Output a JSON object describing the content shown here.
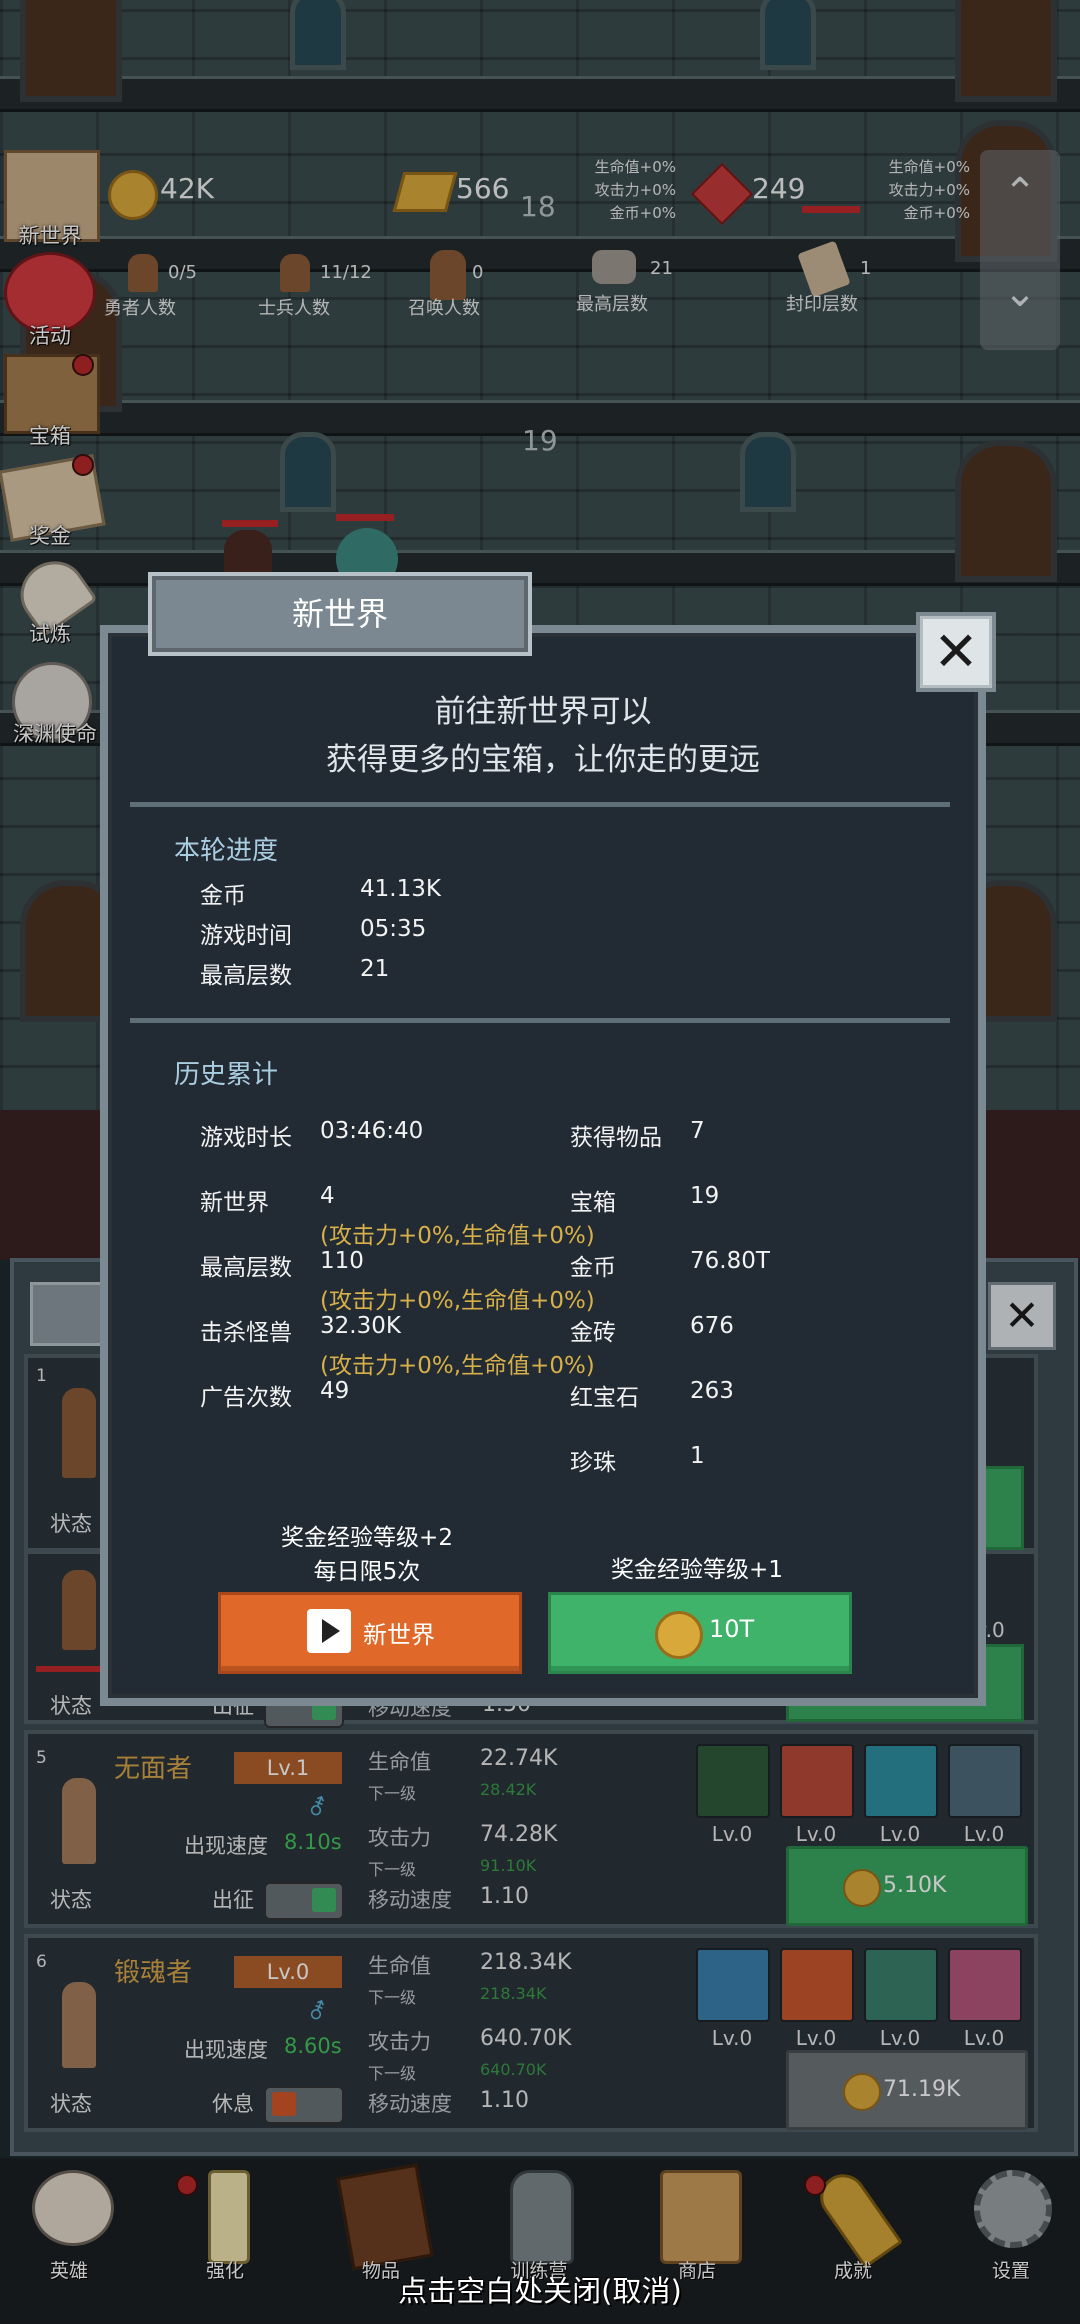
{
  "top": {
    "gold": "42K",
    "gold_bar": "566",
    "ruby": "249",
    "floor_indicator_1": "18",
    "floor_indicator_2": "19",
    "bonus_left": [
      "生命值+0%",
      "攻击力+0%",
      "金币+0%"
    ],
    "bonus_right": [
      "生命值+0%",
      "攻击力+0%",
      "金币+0%"
    ],
    "stats": [
      {
        "value": "0/5",
        "label": "勇者人数"
      },
      {
        "value": "11/12",
        "label": "士兵人数"
      },
      {
        "value": "0",
        "label": "召唤人数"
      },
      {
        "value": "21",
        "label": "最高层数"
      },
      {
        "value": "1",
        "label": "封印层数"
      }
    ]
  },
  "side_menu": [
    {
      "label": "新世界",
      "icon": "map-icon"
    },
    {
      "label": "活动",
      "icon": "heart-icon"
    },
    {
      "label": "宝箱",
      "icon": "chest-icon"
    },
    {
      "label": "奖金",
      "icon": "letter-icon"
    },
    {
      "label": "试炼",
      "icon": "feather-icon"
    },
    {
      "label": "深渊使命",
      "icon": "orb-icon"
    }
  ],
  "dialog": {
    "title": "新世界",
    "intro_line1": "前往新世界可以",
    "intro_line2": "获得更多的宝箱，让你走的更远",
    "round_title": "本轮进度",
    "round": [
      {
        "k": "金币",
        "v": "41.13K"
      },
      {
        "k": "游戏时间",
        "v": "05:35"
      },
      {
        "k": "最高层数",
        "v": "21"
      }
    ],
    "history_title": "历史累计",
    "history_left": [
      {
        "k": "游戏时长",
        "v": "03:46:40",
        "note": ""
      },
      {
        "k": "新世界",
        "v": "4",
        "note": "(攻击力+0%,生命值+0%)"
      },
      {
        "k": "最高层数",
        "v": "110",
        "note": "(攻击力+0%,生命值+0%)"
      },
      {
        "k": "击杀怪兽",
        "v": "32.30K",
        "note": "(攻击力+0%,生命值+0%)"
      },
      {
        "k": "广告次数",
        "v": "49",
        "note": ""
      }
    ],
    "history_right": [
      {
        "k": "获得物品",
        "v": "7"
      },
      {
        "k": "宝箱",
        "v": "19"
      },
      {
        "k": "金币",
        "v": "76.80T"
      },
      {
        "k": "金砖",
        "v": "676"
      },
      {
        "k": "红宝石",
        "v": "263"
      },
      {
        "k": "珍珠",
        "v": "1"
      }
    ],
    "ad_caption_1": "奖金经验等级+2",
    "ad_caption_2": "每日限5次",
    "ad_button": "新世界",
    "pay_caption": "奖金经验等级+1",
    "pay_button": "10T"
  },
  "hero_list": {
    "cards": [
      {
        "index": "5",
        "name": "无面者",
        "level": "Lv.1",
        "spawn_label": "出现速度",
        "spawn_value": "8.10s",
        "state_label": "状态",
        "state_value": "出征",
        "hp_label": "生命值",
        "hp": "22.74K",
        "hp_next_label": "下一级",
        "hp_next": "28.42K",
        "atk_label": "攻击力",
        "atk": "74.28K",
        "atk_next_label": "下一级",
        "atk_next": "91.10K",
        "speed_label": "移动速度",
        "speed": "1.10",
        "equip": [
          "Lv.0",
          "Lv.0",
          "Lv.0",
          "Lv.0"
        ],
        "price": "5.10K"
      },
      {
        "index": "6",
        "name": "锻魂者",
        "level": "Lv.0",
        "spawn_label": "出现速度",
        "spawn_value": "8.60s",
        "state_label": "状态",
        "state_value": "休息",
        "hp_label": "生命值",
        "hp": "218.34K",
        "hp_next_label": "下一级",
        "hp_next": "218.34K",
        "atk_label": "攻击力",
        "atk": "640.70K",
        "atk_next_label": "下一级",
        "atk_next": "640.70K",
        "speed_label": "移动速度",
        "speed": "1.10",
        "equip": [
          "Lv.0",
          "Lv.0",
          "Lv.0",
          "Lv.0"
        ],
        "price": "71.19K"
      }
    ],
    "peek": {
      "card1_index": "1",
      "card1_state": "状态",
      "card2_state": "状态",
      "card2_state_value": "出征",
      "card2_speed_label": "移动速度",
      "card2_speed": "1.50",
      "card2_equip_lv": "v.0"
    }
  },
  "bottom_nav": [
    {
      "label": "英雄",
      "icon": "skull-icon"
    },
    {
      "label": "强化",
      "icon": "candle-icon"
    },
    {
      "label": "物品",
      "icon": "book-icon"
    },
    {
      "label": "训练营",
      "icon": "lantern-icon"
    },
    {
      "label": "商店",
      "icon": "mug-icon"
    },
    {
      "label": "成就",
      "icon": "key-icon"
    },
    {
      "label": "设置",
      "icon": "gear-icon"
    }
  ],
  "footer_hint": "点击空白处关闭(取消)",
  "colors": {
    "dialog_bg": "#222a33",
    "orange_button": "#e0692a",
    "green_button": "#3fb36a",
    "note_gold": "#d7b049"
  }
}
